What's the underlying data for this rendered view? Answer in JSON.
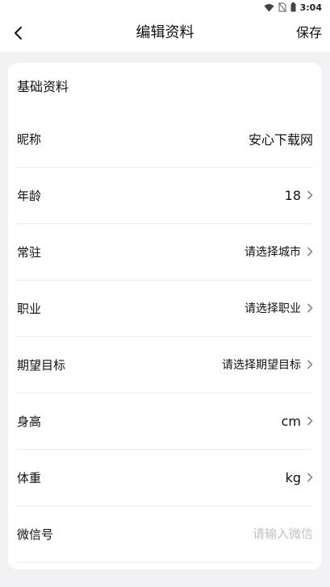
{
  "status_bar": {
    "time": "3:04",
    "icons": [
      "wifi-icon",
      "no-sim-icon",
      "battery-icon"
    ]
  },
  "header": {
    "back_icon": "chevron-left-icon",
    "title": "编辑资料",
    "save_label": "保存"
  },
  "section": {
    "title": "基础资料"
  },
  "rows": [
    {
      "label": "昵称",
      "value": "安心下载网",
      "has_arrow": false
    },
    {
      "label": "年龄",
      "value": "18",
      "has_arrow": true
    },
    {
      "label": "常驻",
      "value": "请选择城市",
      "has_arrow": true
    },
    {
      "label": "职业",
      "value": "请选择职业",
      "has_arrow": true
    },
    {
      "label": "期望目标",
      "value": "请选择期望目标",
      "has_arrow": true
    },
    {
      "label": "身高",
      "value": "cm",
      "has_arrow": true
    },
    {
      "label": "体重",
      "value": "kg",
      "has_arrow": true
    }
  ],
  "wechat": {
    "label": "微信号",
    "value": "",
    "placeholder": "请输入微信"
  },
  "colors": {
    "background": "#f2f2f4",
    "card": "#ffffff",
    "divider": "#ececec",
    "placeholder": "#c2c2c2",
    "chevron": "#8a8a8a"
  }
}
